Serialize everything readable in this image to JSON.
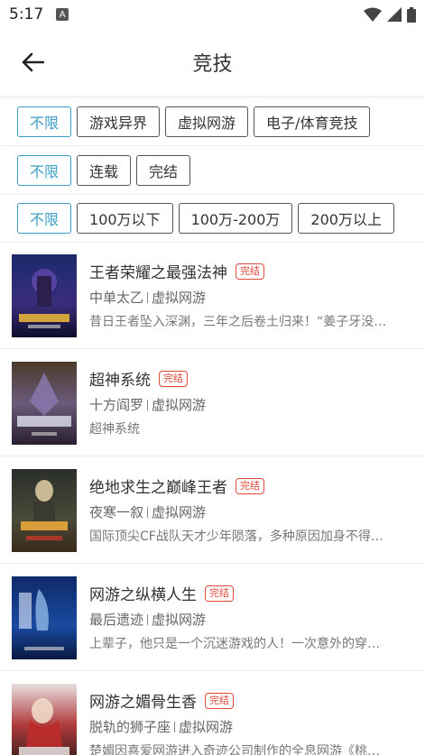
{
  "status_bar": {
    "time": "5:17",
    "notification_glyph": "A"
  },
  "header": {
    "title": "竞技"
  },
  "filters": {
    "category": [
      "不限",
      "游戏异界",
      "虚拟网游",
      "电子/体育竞技"
    ],
    "status": [
      "不限",
      "连载",
      "完结"
    ],
    "word_count": [
      "不限",
      "100万以下",
      "100万-200万",
      "200万以上"
    ]
  },
  "books": [
    {
      "title": "王者荣耀之最强法神",
      "status": "完结",
      "author": "中单太乙",
      "category": "虚拟网游",
      "desc": "昔日王者坠入深渊，三年之后卷土归来！“姜子牙没…"
    },
    {
      "title": "超神系统",
      "status": "完结",
      "author": "十方阎罗",
      "category": "虚拟网游",
      "desc": "超神系统"
    },
    {
      "title": "绝地求生之巅峰王者",
      "status": "完结",
      "author": "夜寒一叙",
      "category": "虚拟网游",
      "desc": "国际顶尖CF战队天才少年陨落，多种原因加身不得…"
    },
    {
      "title": "网游之纵横人生",
      "status": "完结",
      "author": "最后遗迹",
      "category": "虚拟网游",
      "desc": "上辈子，他只是一个沉迷游戏的人！一次意外的穿…"
    },
    {
      "title": "网游之媚骨生香",
      "status": "完结",
      "author": "脱轨的狮子座",
      "category": "虚拟网游",
      "desc": "楚媚因喜爱网游进入奇迹公司制作的全息网游《桃…"
    }
  ],
  "colors": {
    "accent": "#3b9fc6",
    "badge": "#e04a3a"
  }
}
